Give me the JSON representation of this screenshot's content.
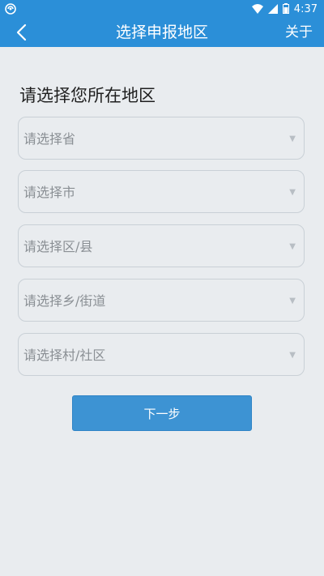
{
  "status_bar": {
    "time": "4:37"
  },
  "app_bar": {
    "title": "选择申报地区",
    "right_action": "关于"
  },
  "section": {
    "heading": "请选择您所在地区"
  },
  "selects": [
    {
      "placeholder": "请选择省"
    },
    {
      "placeholder": "请选择市"
    },
    {
      "placeholder": "请选择区/县"
    },
    {
      "placeholder": "请选择乡/街道"
    },
    {
      "placeholder": "请选择村/社区"
    }
  ],
  "caret_glyph": "▼",
  "next_button": {
    "label": "下一步"
  },
  "colors": {
    "primary": "#2b8fd8",
    "button": "#3d93d3",
    "background": "#e9ecef"
  }
}
